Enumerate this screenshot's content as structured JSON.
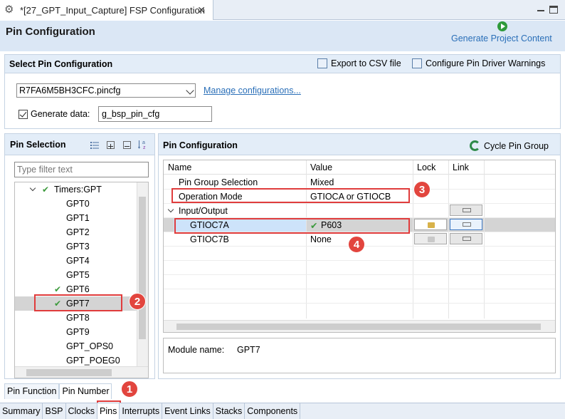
{
  "window": {
    "tab_title": "*[27_GPT_Input_Capture] FSP Configuration",
    "close_glyph": "✕"
  },
  "header": {
    "title": "Pin Configuration",
    "generate_label": "Generate Project Content"
  },
  "select_panel": {
    "title": "Select Pin Configuration",
    "export_label": "Export to CSV file",
    "config_warn_label": "Configure Pin Driver Warnings",
    "config_file": "R7FA6M5BH3CFC.pincfg",
    "manage_link": "Manage configurations...",
    "generate_data_label": "Generate data:",
    "generate_data_checked": true,
    "generate_data_value": "g_bsp_pin_cfg"
  },
  "pin_selection": {
    "title": "Pin Selection",
    "filter_placeholder": "Type filter text",
    "tree": [
      {
        "label": "Timers:GPT",
        "check": true,
        "expanded": true
      },
      {
        "label": "GPT0"
      },
      {
        "label": "GPT1"
      },
      {
        "label": "GPT2"
      },
      {
        "label": "GPT3"
      },
      {
        "label": "GPT4"
      },
      {
        "label": "GPT5"
      },
      {
        "label": "GPT6",
        "check": true
      },
      {
        "label": "GPT7",
        "check": true,
        "selected": true
      },
      {
        "label": "GPT8"
      },
      {
        "label": "GPT9"
      },
      {
        "label": "GPT_OPS0"
      },
      {
        "label": "GPT_POEG0"
      }
    ]
  },
  "pin_config": {
    "title": "Pin Configuration",
    "cycle_label": "Cycle Pin Group",
    "columns": [
      "Name",
      "Value",
      "Lock",
      "Link"
    ],
    "rows": [
      {
        "name": "Pin Group Selection",
        "value": "Mixed"
      },
      {
        "name": "Operation Mode",
        "value": "GTIOCA or GTIOCB"
      },
      {
        "name": "Input/Output",
        "value": ""
      },
      {
        "name": "GTIOC7A",
        "value": "P603",
        "value_check": true
      },
      {
        "name": "GTIOC7B",
        "value": "None"
      }
    ],
    "module_name_label": "Module name:",
    "module_name_value": "GPT7"
  },
  "badges": [
    "1",
    "2",
    "3",
    "4"
  ],
  "sub_tabs": [
    {
      "label": "Pin Function",
      "active": false
    },
    {
      "label": "Pin Number",
      "active": true
    }
  ],
  "editor_tabs": [
    {
      "label": "Summary",
      "active": false
    },
    {
      "label": "BSP",
      "active": false
    },
    {
      "label": "Clocks",
      "active": false
    },
    {
      "label": "Pins",
      "active": true
    },
    {
      "label": "Interrupts",
      "active": false
    },
    {
      "label": "Event Links",
      "active": false
    },
    {
      "label": "Stacks",
      "active": false
    },
    {
      "label": "Components",
      "active": false
    }
  ],
  "colors": {
    "accent_link": "#2a6fb8",
    "highlight": "#e03c3c",
    "check_green": "#3c9a3c"
  }
}
